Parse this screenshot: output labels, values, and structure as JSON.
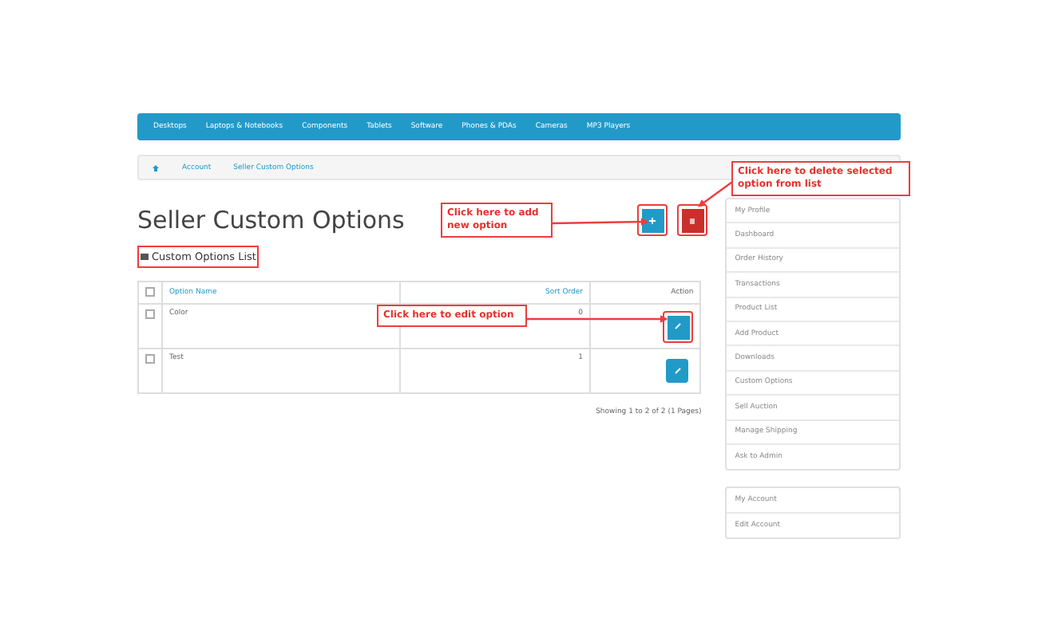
{
  "nav": [
    "Desktops",
    "Laptops & Notebooks",
    "Components",
    "Tablets",
    "Software",
    "Phones & PDAs",
    "Cameras",
    "MP3 Players"
  ],
  "breadcrumb": [
    "Account",
    "Seller Custom Options"
  ],
  "title": "Seller Custom Options",
  "subtitle": "Custom Options List",
  "add_button": {
    "highlighted": true
  },
  "delete_button": {
    "highlighted": true
  },
  "table": {
    "select_all_checked": false,
    "columns": [
      "Option Name",
      "Sort Order",
      "Action"
    ],
    "rows": [
      {
        "name": "Color",
        "sort": "0",
        "checked": false,
        "highlighted": true
      },
      {
        "name": "Test",
        "sort": "1",
        "checked": false,
        "highlighted": false
      }
    ]
  },
  "pagination": "Showing 1 to 2 of 2 (1 Pages)",
  "sidebar": [
    [
      "My Profile",
      "Dashboard",
      "Order History",
      "Transactions",
      "Product List",
      "Add Product",
      "Downloads",
      "Custom Options",
      "Sell Auction",
      "Manage Shipping",
      "Ask to Admin"
    ],
    [
      "My Account",
      "Edit Account"
    ]
  ],
  "callouts": [
    {
      "kind": "delete",
      "text": "Click here to delete selected option from list"
    },
    {
      "kind": "add",
      "text": "Click here to add new option"
    },
    {
      "kind": "edit",
      "text": "Click here to edit option"
    }
  ]
}
